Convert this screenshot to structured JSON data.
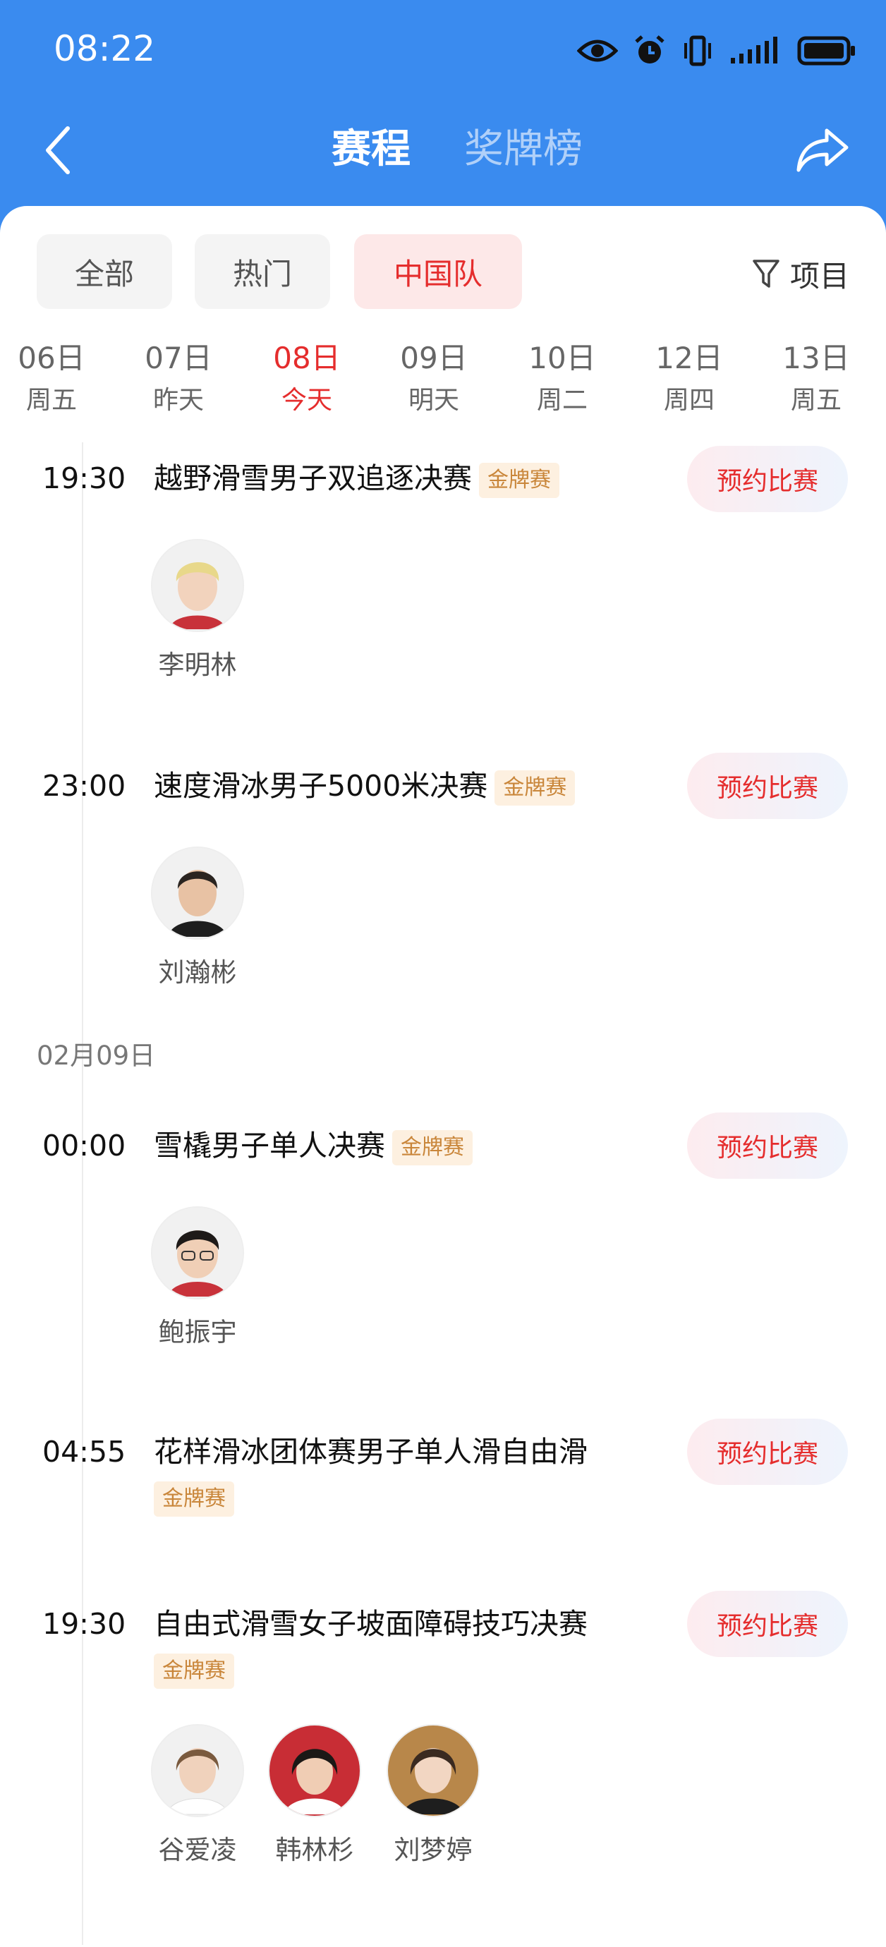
{
  "status_bar": {
    "time": "08:22",
    "icons": [
      "eye-icon",
      "alarm-icon",
      "vibrate-icon",
      "signal-icon",
      "battery-icon"
    ]
  },
  "header": {
    "tabs": [
      {
        "label": "赛程",
        "active": true
      },
      {
        "label": "奖牌榜",
        "active": false
      }
    ],
    "back_icon": "chevron-left-icon",
    "share_icon": "share-icon",
    "color": "#3a8bef"
  },
  "filters": {
    "chips": [
      {
        "label": "全部",
        "active": false
      },
      {
        "label": "热门",
        "active": false
      },
      {
        "label": "中国队",
        "active": true
      }
    ],
    "item_filter_label": "项目"
  },
  "dates": [
    {
      "day": "06日",
      "weekday": "周五",
      "active": false
    },
    {
      "day": "07日",
      "weekday": "昨天",
      "active": false
    },
    {
      "day": "08日",
      "weekday": "今天",
      "active": true
    },
    {
      "day": "09日",
      "weekday": "明天",
      "active": false
    },
    {
      "day": "10日",
      "weekday": "周二",
      "active": false
    },
    {
      "day": "12日",
      "weekday": "周四",
      "active": false
    },
    {
      "day": "13日",
      "weekday": "周五",
      "active": false
    }
  ],
  "events": [
    {
      "time": "19:30",
      "title": "越野滑雪男子双追逐决赛",
      "tag": "金牌赛",
      "button": "预约比赛",
      "athletes": [
        "李明林"
      ]
    },
    {
      "time": "23:00",
      "title": "速度滑冰男子5000米决赛",
      "tag": "金牌赛",
      "button": "预约比赛",
      "athletes": [
        "刘瀚彬"
      ]
    },
    {
      "time": "00:00",
      "title": "雪橇男子单人决赛",
      "tag": "金牌赛",
      "button": "预约比赛",
      "athletes": [
        "鲍振宇"
      ]
    },
    {
      "time": "04:55",
      "title": "花样滑冰团体赛男子单人滑自由滑",
      "tag": "金牌赛",
      "button": "预约比赛",
      "athletes": []
    },
    {
      "time": "19:30",
      "title": "自由式滑雪女子坡面障碍技巧决赛",
      "tag": "金牌赛",
      "button": "预约比赛",
      "athletes": [
        "谷爱凌",
        "韩林杉",
        "刘梦婷"
      ]
    }
  ],
  "section_date": "02月09日",
  "colors": {
    "accent_red": "#e52d2d",
    "gold_tag": "#c9863a"
  }
}
